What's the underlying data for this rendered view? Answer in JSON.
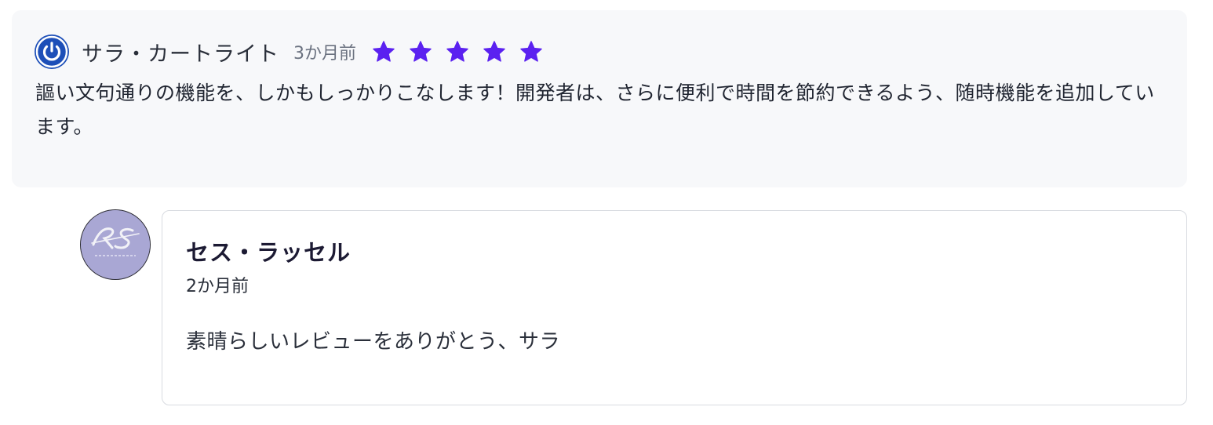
{
  "review": {
    "author": "サラ・カートライト",
    "time": "3か月前",
    "rating": 5,
    "star_color": "#5b21f0",
    "avatar_color": "#1d4fb8",
    "avatar_icon": "power-icon",
    "body": "謳い文句通りの機能を、しかもしっかりこなします！開発者は、さらに便利で時間を節約できるよう、随時機能を追加しています。"
  },
  "reply": {
    "author": "セス・ラッセル",
    "time": "2か月前",
    "avatar_logo_text": "RS",
    "avatar_color": "#a9a7d4",
    "body": "素晴らしいレビューをありがとう、サラ"
  }
}
